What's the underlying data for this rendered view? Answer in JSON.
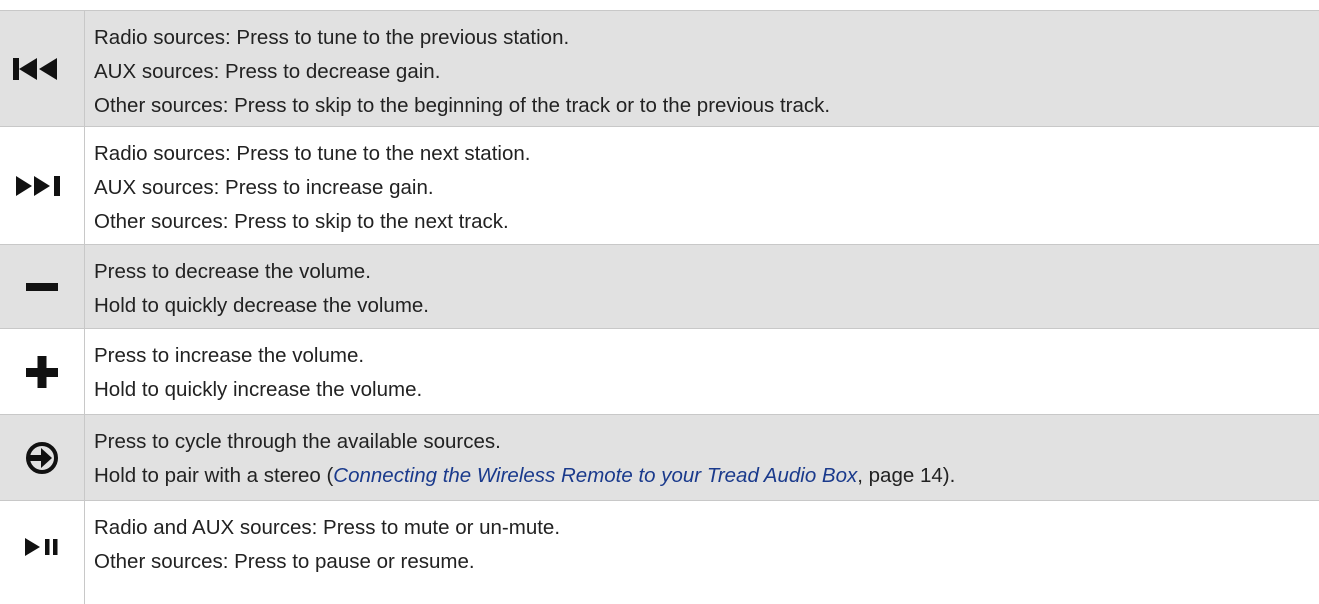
{
  "rows": [
    {
      "icon": "previous-track-icon",
      "lines": [
        "Radio sources: Press to tune to the previous station.",
        "AUX sources: Press to decrease gain.",
        "Other sources: Press to skip to the beginning of the track or to the previous track."
      ]
    },
    {
      "icon": "next-track-icon",
      "lines": [
        "Radio sources: Press to tune to the next station.",
        "AUX sources: Press to increase gain.",
        "Other sources: Press to skip to the next track."
      ]
    },
    {
      "icon": "minus-icon",
      "lines": [
        "Press to decrease the volume.",
        "Hold to quickly decrease the volume."
      ]
    },
    {
      "icon": "plus-icon",
      "lines": [
        "Press to increase the volume.",
        "Hold to quickly increase the volume."
      ]
    },
    {
      "icon": "source-icon",
      "lines": [
        "Press to cycle through the available sources."
      ],
      "hold_line": {
        "prefix": "Hold to pair with a stereo (",
        "link": "Connecting the Wireless Remote to your Tread Audio Box",
        "suffix": ", page 14)."
      }
    },
    {
      "icon": "play-pause-icon",
      "lines": [
        "Radio and AUX sources: Press to mute or un-mute.",
        "Other sources: Press to pause or resume."
      ]
    }
  ],
  "colors": {
    "shaded_row": "#e1e1e1",
    "text": "#222222",
    "link": "#1a3a8c",
    "rule": "#c8c8c8"
  }
}
